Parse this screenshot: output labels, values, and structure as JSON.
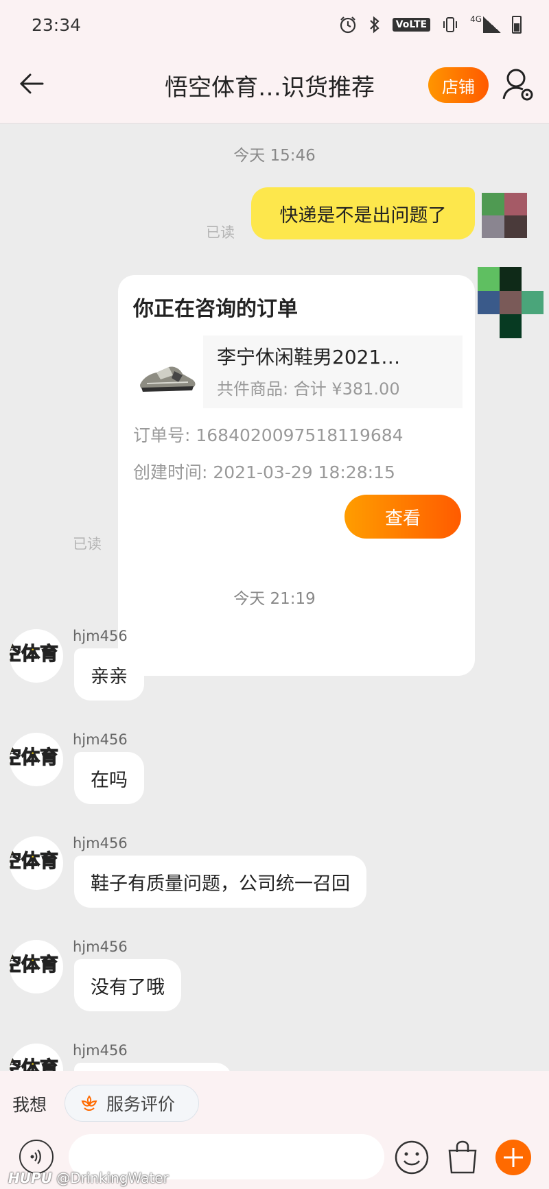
{
  "status_bar": {
    "time": "23:34",
    "lte_label": "VoLTE",
    "network": "4G",
    "icons": [
      "alarm-icon",
      "bluetooth-icon",
      "volte-icon",
      "vibrate-icon",
      "signal-icon",
      "battery-icon"
    ]
  },
  "nav": {
    "title": "悟空体育…识货推荐",
    "shop_label": "店铺",
    "back_icon": "back-arrow-icon",
    "person_icon": "person-settings-icon"
  },
  "chat": {
    "timestamps": [
      "今天  15:46",
      "今天  21:19"
    ],
    "read_label": "已读",
    "my_message": "快递是不是出问题了",
    "order_card": {
      "title": "你正在咨询的订单",
      "product_name": "李宁休闲鞋男2021…",
      "total_label": "共件商品:  合计  ¥381.00",
      "order_no_label": "订单号:  1684020097518119684",
      "created_label": "创建时间:  2021-03-29 18:28:15",
      "view_button": "查看"
    },
    "incoming": [
      {
        "sender": "hjm456",
        "text": "亲亲"
      },
      {
        "sender": "hjm456",
        "text": "在吗"
      },
      {
        "sender": "hjm456",
        "text": "鞋子有质量问题，公司统一召回"
      },
      {
        "sender": "hjm456",
        "text": "没有了哦"
      },
      {
        "sender": "hjm456",
        "text": ""
      }
    ],
    "avatar_text": "空体育"
  },
  "bottom_bar": {
    "wx_label": "我想",
    "review_label": "服务评价",
    "input_value": "",
    "watermark_brand": "HUPU",
    "watermark_user": "@DrinkingWater",
    "colors": {
      "accent": "#ff6a00",
      "bubble_mine": "#fde74c"
    }
  }
}
